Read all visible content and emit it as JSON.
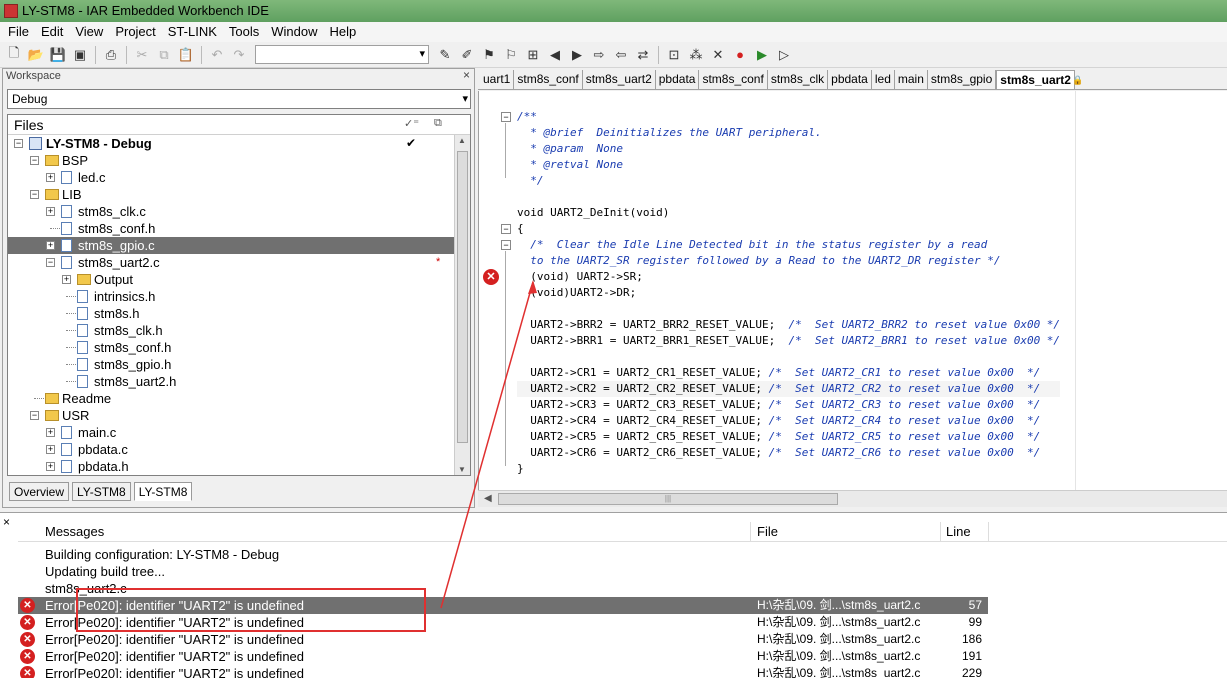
{
  "window": {
    "title": "LY-STM8 - IAR Embedded Workbench IDE"
  },
  "menu": [
    "File",
    "Edit",
    "View",
    "Project",
    "ST-LINK",
    "Tools",
    "Window",
    "Help"
  ],
  "workspace": {
    "header": "Workspace",
    "config": "Debug",
    "files_label": "Files",
    "tree": [
      {
        "label": "LY-STM8 - Debug",
        "level": 0,
        "kind": "project",
        "expander": "minus",
        "check": "✔"
      },
      {
        "label": "BSP",
        "level": 1,
        "kind": "folder",
        "expander": "minus"
      },
      {
        "label": "led.c",
        "level": 2,
        "kind": "file",
        "expander": "plus"
      },
      {
        "label": "LIB",
        "level": 1,
        "kind": "folder",
        "expander": "minus"
      },
      {
        "label": "stm8s_clk.c",
        "level": 2,
        "kind": "file",
        "expander": "plus"
      },
      {
        "label": "stm8s_conf.h",
        "level": 2,
        "kind": "file",
        "expander": "none"
      },
      {
        "label": "stm8s_gpio.c",
        "level": 2,
        "kind": "file",
        "expander": "plus",
        "selected": true
      },
      {
        "label": "stm8s_uart2.c",
        "level": 2,
        "kind": "file",
        "expander": "minus",
        "star": "*"
      },
      {
        "label": "Output",
        "level": 3,
        "kind": "folder",
        "expander": "plus"
      },
      {
        "label": "intrinsics.h",
        "level": 3,
        "kind": "file",
        "expander": "none"
      },
      {
        "label": "stm8s.h",
        "level": 3,
        "kind": "file",
        "expander": "none"
      },
      {
        "label": "stm8s_clk.h",
        "level": 3,
        "kind": "file",
        "expander": "none"
      },
      {
        "label": "stm8s_conf.h",
        "level": 3,
        "kind": "file",
        "expander": "none"
      },
      {
        "label": "stm8s_gpio.h",
        "level": 3,
        "kind": "file",
        "expander": "none"
      },
      {
        "label": "stm8s_uart2.h",
        "level": 3,
        "kind": "file",
        "expander": "none"
      },
      {
        "label": "Readme",
        "level": 1,
        "kind": "folder",
        "expander": "none"
      },
      {
        "label": "USR",
        "level": 1,
        "kind": "folder",
        "expander": "minus"
      },
      {
        "label": "main.c",
        "level": 2,
        "kind": "file",
        "expander": "plus"
      },
      {
        "label": "pbdata.c",
        "level": 2,
        "kind": "file",
        "expander": "plus"
      },
      {
        "label": "pbdata.h",
        "level": 2,
        "kind": "file",
        "expander": "plus"
      }
    ],
    "tabs": [
      "Overview",
      "LY-STM8",
      "LY-STM8"
    ]
  },
  "editor": {
    "tabs": [
      "uart1",
      "stm8s_conf",
      "stm8s_uart2",
      "pbdata",
      "stm8s_conf",
      "stm8s_clk",
      "pbdata",
      "led",
      "main",
      "stm8s_gpio",
      "stm8s_uart2"
    ],
    "active_tab": 10,
    "code": [
      {
        "text": "/**",
        "cls": "cmt"
      },
      {
        "text": "  * @brief  Deinitializes the UART peripheral.",
        "cls": "cmt"
      },
      {
        "text": "  * @param  None",
        "cls": "cmt"
      },
      {
        "text": "  * @retval None",
        "cls": "cmt"
      },
      {
        "text": "  */",
        "cls": "cmt"
      },
      {
        "text": "",
        "cls": ""
      },
      {
        "text": "void UART2_DeInit(void)",
        "cls": ""
      },
      {
        "text": "{",
        "cls": ""
      },
      {
        "text": "  /*  Clear the Idle Line Detected bit in the status register by a read",
        "cls": "cmt"
      },
      {
        "text": "  to the UART2_SR register followed by a Read to the UART2_DR register */",
        "cls": "cmt"
      },
      {
        "text": "  (void) UART2->SR;",
        "cls": ""
      },
      {
        "text": "  (void)UART2->DR;",
        "cls": ""
      },
      {
        "text": "",
        "cls": ""
      },
      {
        "text": "  UART2->BRR2 = UART2_BRR2_RESET_VALUE;  /*  Set UART2_BRR2 to reset value 0x00 */",
        "cls": "mix"
      },
      {
        "text": "  UART2->BRR1 = UART2_BRR1_RESET_VALUE;  /*  Set UART2_BRR1 to reset value 0x00 */",
        "cls": "mix"
      },
      {
        "text": "",
        "cls": ""
      },
      {
        "text": "  UART2->CR1 = UART2_CR1_RESET_VALUE; /*  Set UART2_CR1 to reset value 0x00  */",
        "cls": "mix"
      },
      {
        "text": "  UART2->CR2 = UART2_CR2_RESET_VALUE; /*  Set UART2_CR2 to reset value 0x00  */",
        "cls": "mix hl"
      },
      {
        "text": "  UART2->CR3 = UART2_CR3_RESET_VALUE; /*  Set UART2_CR3 to reset value 0x00  */",
        "cls": "mix"
      },
      {
        "text": "  UART2->CR4 = UART2_CR4_RESET_VALUE; /*  Set UART2_CR4 to reset value 0x00  */",
        "cls": "mix"
      },
      {
        "text": "  UART2->CR5 = UART2_CR5_RESET_VALUE; /*  Set UART2_CR5 to reset value 0x00  */",
        "cls": "mix"
      },
      {
        "text": "  UART2->CR6 = UART2_CR6_RESET_VALUE; /*  Set UART2_CR6 to reset value 0x00  */",
        "cls": "mix"
      },
      {
        "text": "}",
        "cls": ""
      }
    ]
  },
  "messages": {
    "columns": {
      "messages": "Messages",
      "file": "File",
      "line": "Line"
    },
    "rows": [
      {
        "text": "Building configuration: LY-STM8 - Debug",
        "error": false,
        "file": "",
        "line": ""
      },
      {
        "text": "Updating build tree...",
        "error": false,
        "file": "",
        "line": ""
      },
      {
        "text": "stm8s_uart2.c",
        "error": false,
        "file": "",
        "line": ""
      },
      {
        "text": "Error[Pe020]: identifier \"UART2\" is undefined",
        "error": true,
        "file": "H:\\杂乱\\09. 剑...\\stm8s_uart2.c",
        "line": "57",
        "selected": true
      },
      {
        "text": "Error[Pe020]: identifier \"UART2\" is undefined",
        "error": true,
        "file": "H:\\杂乱\\09. 剑...\\stm8s_uart2.c",
        "line": "99"
      },
      {
        "text": "Error[Pe020]: identifier \"UART2\" is undefined",
        "error": true,
        "file": "H:\\杂乱\\09. 剑...\\stm8s_uart2.c",
        "line": "186"
      },
      {
        "text": "Error[Pe020]: identifier \"UART2\" is undefined",
        "error": true,
        "file": "H:\\杂乱\\09. 剑...\\stm8s_uart2.c",
        "line": "191"
      },
      {
        "text": "Error[Pe020]: identifier \"UART2\" is undefined",
        "error": true,
        "file": "H:\\杂乱\\09. 剑...\\stm8s_uart2.c",
        "line": "229"
      }
    ]
  },
  "colors": {
    "annotation": "#e03030",
    "error": "#d42020",
    "comment": "#1a3cb0",
    "selection": "#707070"
  }
}
